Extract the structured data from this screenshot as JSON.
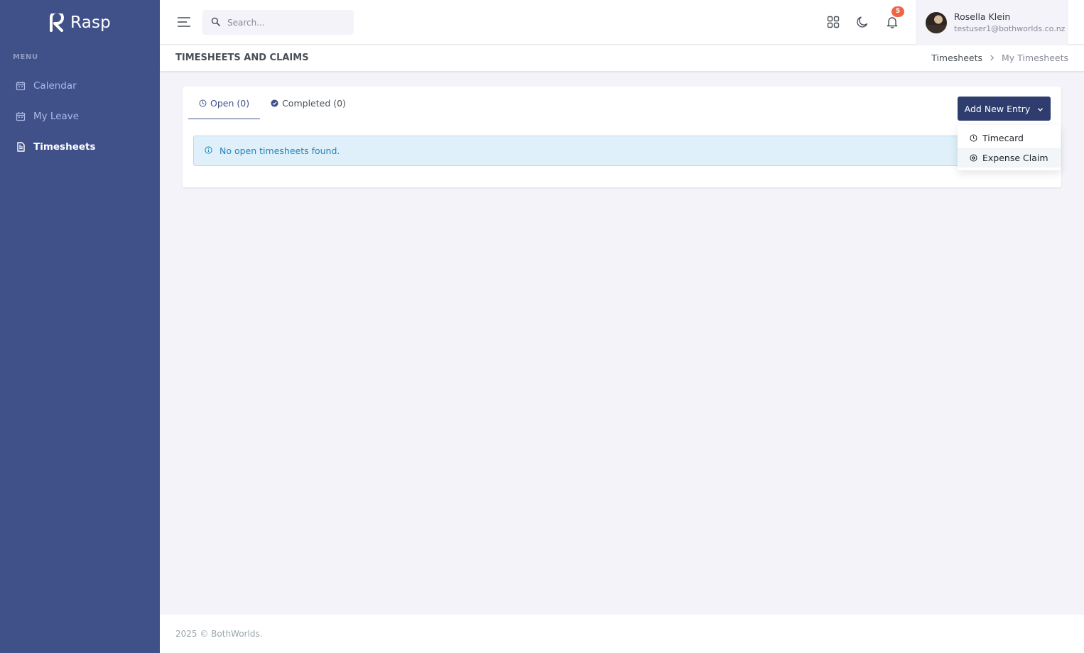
{
  "app": {
    "brand_name": "Rasp",
    "accent_color": "#405189",
    "primary_button_color": "#2f3d6e"
  },
  "sidebar": {
    "menu_title": "MENU",
    "items": [
      {
        "label": "Calendar",
        "icon": "calendar-icon",
        "active": false
      },
      {
        "label": "My Leave",
        "icon": "calendar-icon",
        "active": false
      },
      {
        "label": "Timesheets",
        "icon": "document-icon",
        "active": true
      }
    ]
  },
  "topbar": {
    "search_placeholder": "Search...",
    "notification_count": "5",
    "user": {
      "name": "Rosella Klein",
      "email": "testuser1@bothworlds.co.nz"
    }
  },
  "page": {
    "title": "TIMESHEETS AND CLAIMS",
    "breadcrumb": {
      "parent": "Timesheets",
      "current": "My Timesheets"
    }
  },
  "tabs": [
    {
      "label": "Open (0)",
      "icon": "clock-icon",
      "active": true
    },
    {
      "label": "Completed (0)",
      "icon": "check-circle-icon",
      "active": false
    }
  ],
  "add_button": {
    "label": "Add New Entry"
  },
  "dropdown": {
    "items": [
      {
        "label": "Timecard",
        "icon": "clock-icon"
      },
      {
        "label": "Expense Claim",
        "icon": "dollar-circle-icon"
      }
    ]
  },
  "alert": {
    "message": "No open timesheets found.",
    "icon": "info-icon"
  },
  "footer": {
    "text": "2025 © BothWorlds."
  }
}
